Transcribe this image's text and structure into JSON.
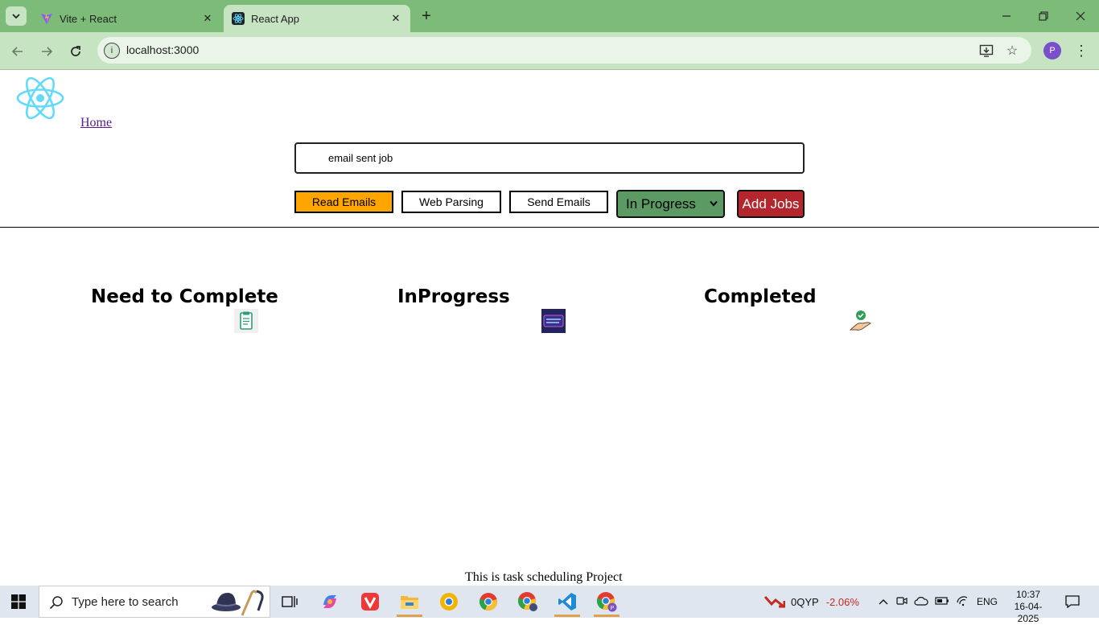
{
  "browser": {
    "tabs": [
      {
        "title": "Vite + React",
        "active": false
      },
      {
        "title": "React App",
        "active": true
      }
    ],
    "url": "localhost:3000",
    "profile_initial": "P"
  },
  "header": {
    "home_link": "Home"
  },
  "search": {
    "value": "email sent job"
  },
  "actions": {
    "read_emails": "Read Emails",
    "web_parsing": "Web Parsing",
    "send_emails": "Send Emails",
    "status_selected": "In Progress",
    "add_jobs": "Add Jobs"
  },
  "columns": [
    {
      "title": "Need to Complete",
      "icon": "clipboard-icon"
    },
    {
      "title": "InProgress",
      "icon": "in-progress-badge-icon"
    },
    {
      "title": "Completed",
      "icon": "hand-check-icon"
    }
  ],
  "footer": {
    "text": "This is task scheduling Project"
  },
  "taskbar": {
    "search_placeholder": "Type here to search",
    "stock_ticker": "0QYP",
    "stock_change": "-2.06%",
    "language": "ENG",
    "time": "10:37",
    "date": "16-04-2025"
  },
  "colors": {
    "tabstrip": "#7dbb78",
    "toolbar": "#c6e3c2",
    "read_emails_bg": "#ffa500",
    "status_select_bg": "#5c9a64",
    "add_jobs_bg": "#b3262c",
    "stock_negative": "#c42b1c"
  }
}
